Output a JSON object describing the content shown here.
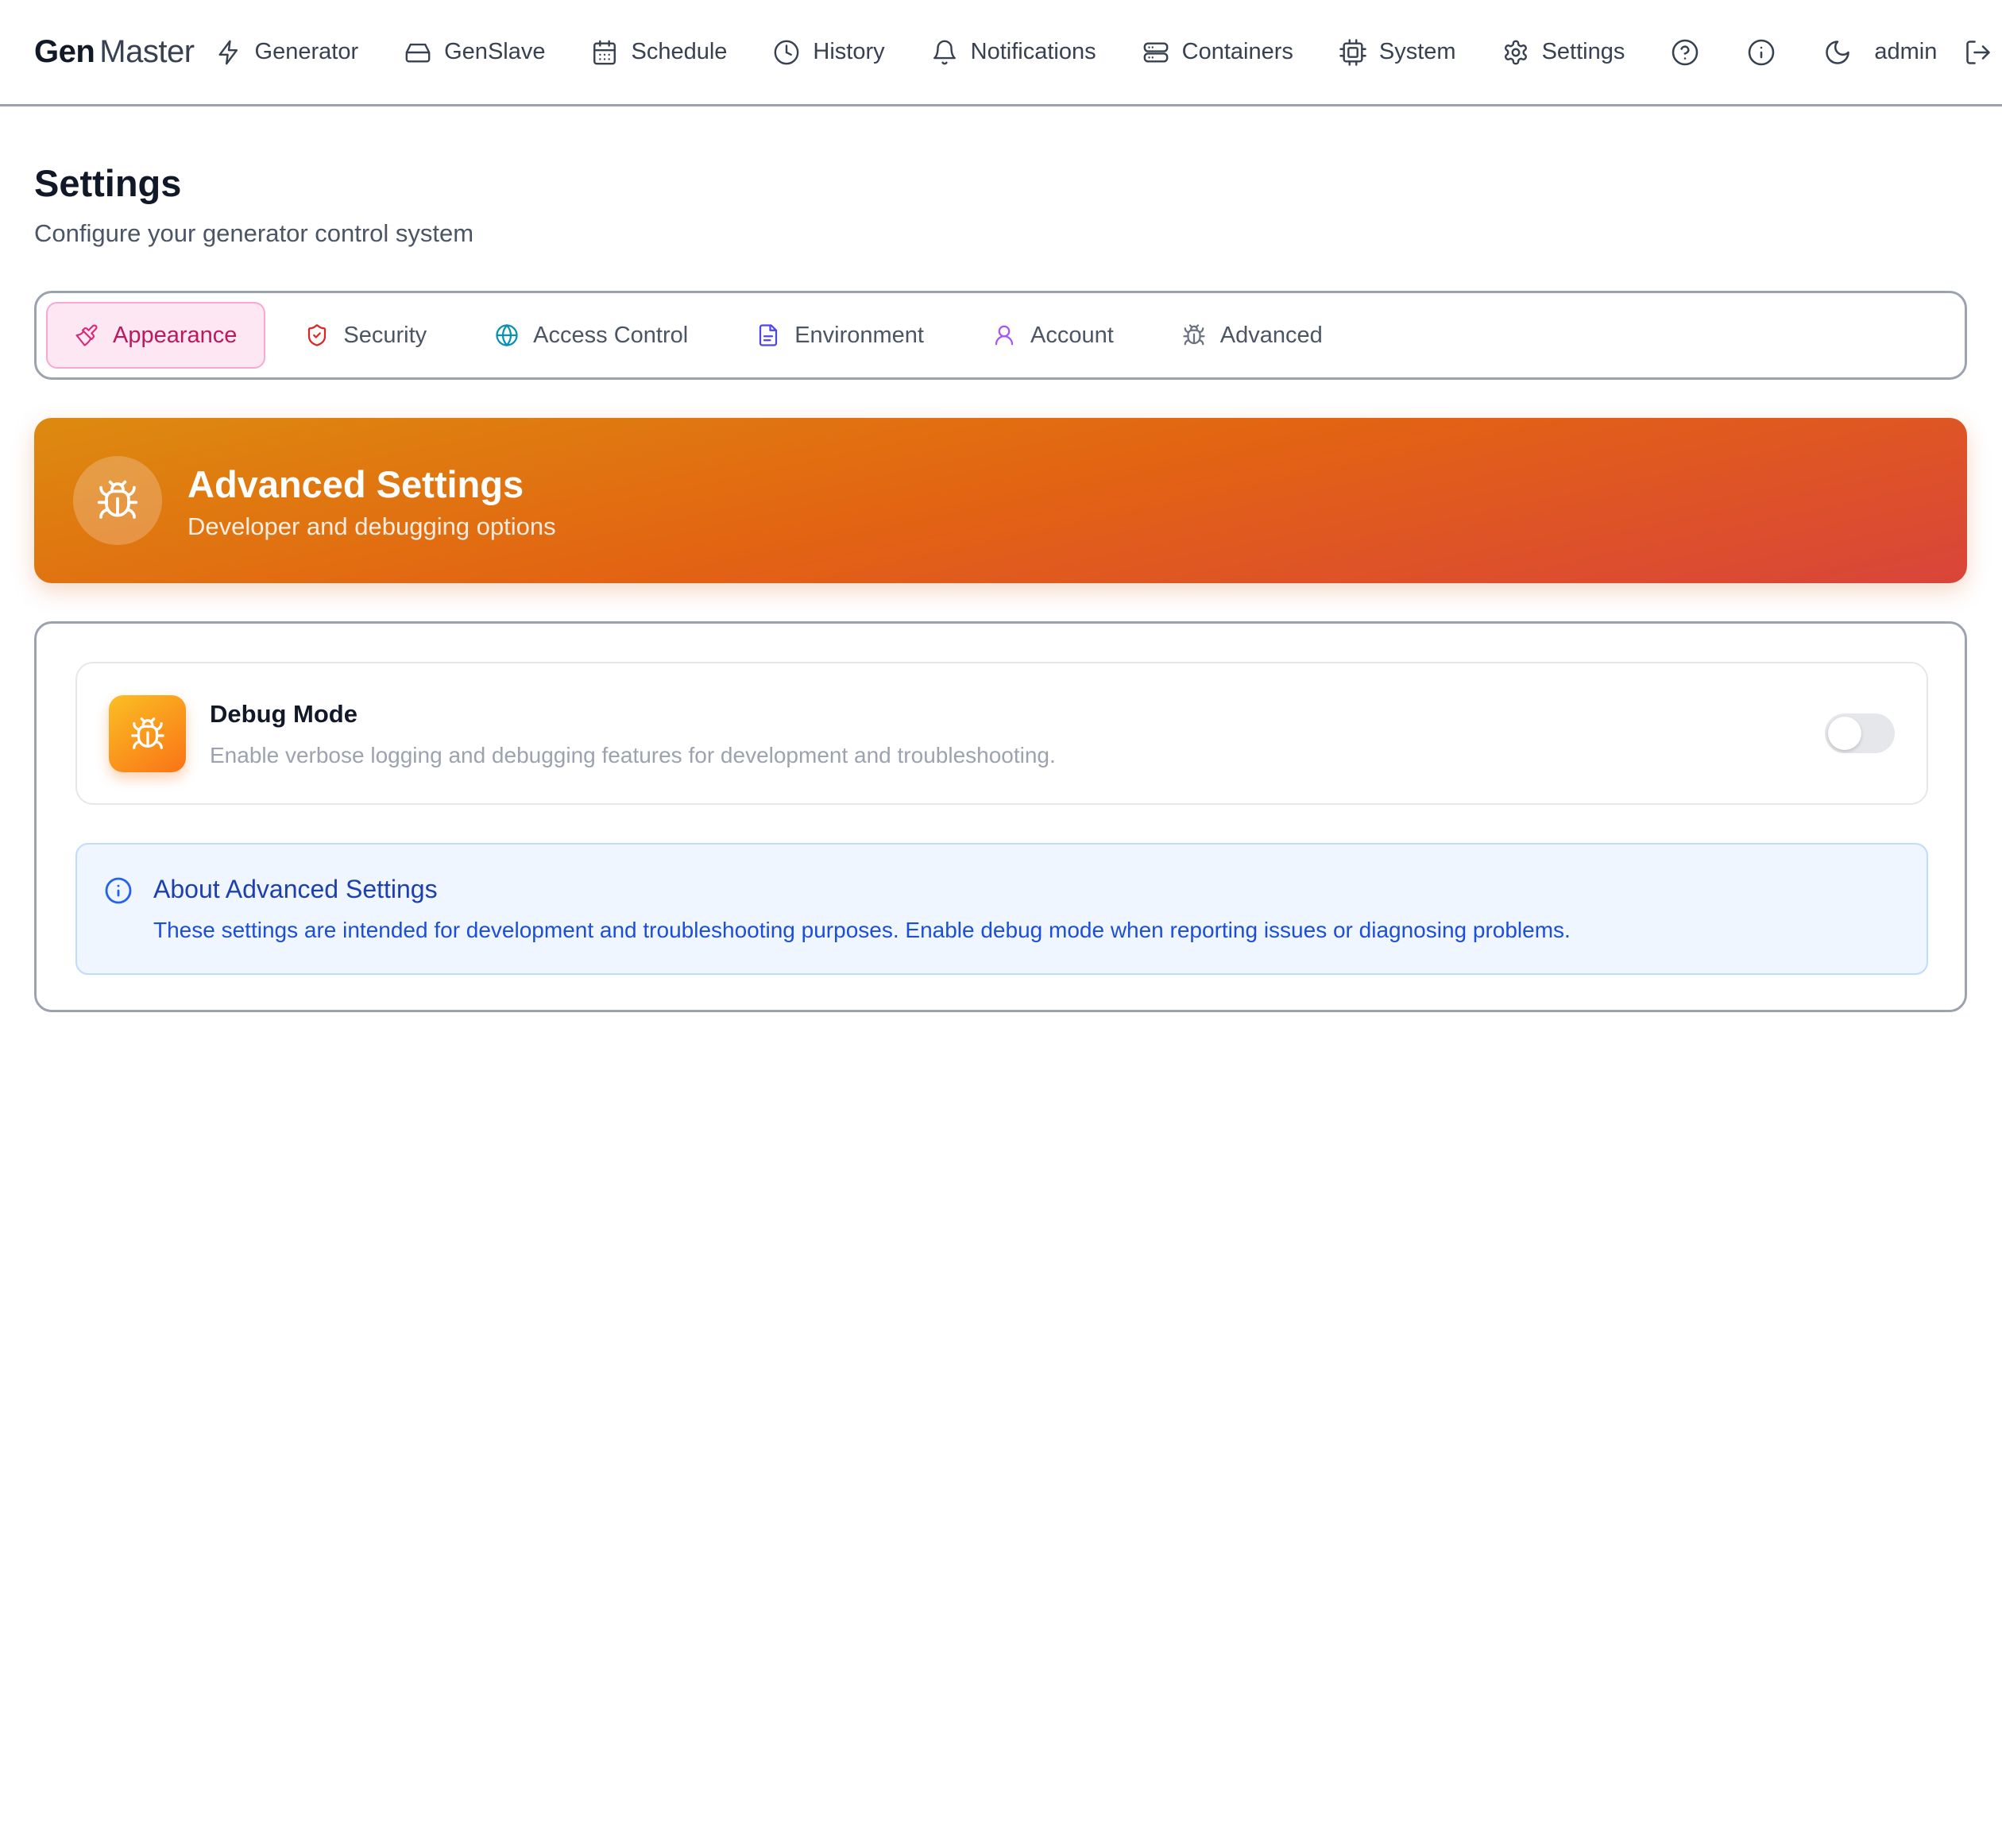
{
  "nav": {
    "brand_bold": "Gen",
    "brand_light": "Master",
    "items": [
      {
        "label": "Generator",
        "icon": "bolt-icon"
      },
      {
        "label": "GenSlave",
        "icon": "hard-drive-icon"
      },
      {
        "label": "Schedule",
        "icon": "calendar-icon"
      },
      {
        "label": "History",
        "icon": "clock-icon"
      },
      {
        "label": "Notifications",
        "icon": "bell-icon"
      },
      {
        "label": "Containers",
        "icon": "server-icon"
      },
      {
        "label": "System",
        "icon": "cpu-icon"
      },
      {
        "label": "Settings",
        "icon": "gear-icon"
      }
    ],
    "utility_icons": [
      "help-circle-icon",
      "info-circle-icon",
      "moon-icon",
      "logout-icon"
    ],
    "user": "admin"
  },
  "page": {
    "title": "Settings",
    "subtitle": "Configure your generator control system"
  },
  "tabs": [
    {
      "label": "Appearance",
      "icon": "paintbrush-icon",
      "color": "#db2777",
      "active": true
    },
    {
      "label": "Security",
      "icon": "shield-check-icon",
      "color": "#dc2626"
    },
    {
      "label": "Access Control",
      "icon": "globe-icon",
      "color": "#0891b2"
    },
    {
      "label": "Environment",
      "icon": "file-text-icon",
      "color": "#4f46e5"
    },
    {
      "label": "Account",
      "icon": "user-icon",
      "color": "#a855f7"
    },
    {
      "label": "Advanced",
      "icon": "bug-icon",
      "color": "#6b7280"
    }
  ],
  "banner": {
    "title": "Advanced Settings",
    "subtitle": "Developer and debugging options",
    "icon": "bug-icon",
    "gradient_from": "#dd8a0f",
    "gradient_to": "#d9443a"
  },
  "settings": {
    "debug_mode": {
      "title": "Debug Mode",
      "description": "Enable verbose logging and debugging features for development and troubleshooting.",
      "enabled": false
    }
  },
  "info": {
    "title": "About Advanced Settings",
    "text": "These settings are intended for development and troubleshooting purposes. Enable debug mode when reporting issues or diagnosing problems."
  }
}
